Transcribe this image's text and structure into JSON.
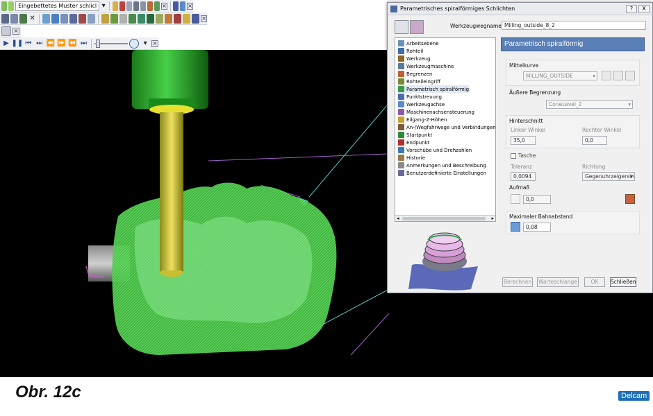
{
  "toolbar": {
    "pattern_combo": "Eingebettetes Muster schlicl"
  },
  "dialog": {
    "title": "Parametrisches spiralförmiges Schlichten",
    "help_label": "?",
    "close_label": "X",
    "toolpath_name_label": "Werkzeugwegname",
    "toolpath_name": "Milling_outside_8_2",
    "section_title": "Parametrisch spiralförmig",
    "tree": [
      {
        "label": "Arbeitsebene",
        "color": "#6a8fb8"
      },
      {
        "label": "Rohteil",
        "color": "#3f6fa8"
      },
      {
        "label": "Werkzeug",
        "color": "#8a6a2a"
      },
      {
        "label": "Werkzeugmaschine",
        "color": "#5a7a9a"
      },
      {
        "label": "Begrenzen",
        "color": "#c06030"
      },
      {
        "label": "Rohteileingriff",
        "color": "#7a8a3a"
      },
      {
        "label": "Parametrisch spiralförmig",
        "color": "#3a9a4a"
      },
      {
        "label": "Punktstreuung",
        "color": "#4a6aa8"
      },
      {
        "label": "Werkzeugachse",
        "color": "#5a8ac8"
      },
      {
        "label": "Maschinenachsensteuerung",
        "color": "#8a5aa8"
      },
      {
        "label": "Eilgang-Z-Höhen",
        "color": "#c8a030"
      },
      {
        "label": "An-/Wegfahrwege und Verbindungen",
        "color": "#7a5a3a"
      },
      {
        "label": "Startpunkt",
        "color": "#2a8a3a"
      },
      {
        "label": "Endpunkt",
        "color": "#b03030"
      },
      {
        "label": "Vorschübe und Drehzahlen",
        "color": "#3a7ab8"
      },
      {
        "label": "Historie",
        "color": "#9a7a4a"
      },
      {
        "label": "Anmerkungen und Beschreibung",
        "color": "#8a8a8a"
      },
      {
        "label": "Benutzerdefinierte Einstellungen",
        "color": "#6a6a9a"
      }
    ],
    "mittelkurve_label": "Mittelkurve",
    "mittelkurve_value": "MILLING_OUTSIDE",
    "aeussere_label": "Äußere Begrenzung",
    "aeussere_value": "ConeLevel_2",
    "hinterschnitt_label": "Hinterschnitt",
    "linker_winkel_label": "Linker Winkel",
    "linker_winkel_value": "35,0",
    "rechter_winkel_label": "Rechter Winkel",
    "rechter_winkel_value": "0,0",
    "tasche_label": "Tasche",
    "toleranz_label": "Toleranz",
    "toleranz_value": "0,0094",
    "richtung_label": "Richtung",
    "richtung_value": "Gegenuhrzeigersin",
    "aufmass_label": "Aufmaß",
    "aufmass_value": "0,0",
    "bahnabstand_label": "Maximaler Bahnabstand",
    "bahnabstand_value": "0,08",
    "btn_berechnen": "Berechnen",
    "btn_warteschlange": "Warteschlange",
    "btn_ok": "OK",
    "btn_schliessen": "Schließen"
  },
  "caption": "Obr. 12c",
  "brand": "Delcam"
}
